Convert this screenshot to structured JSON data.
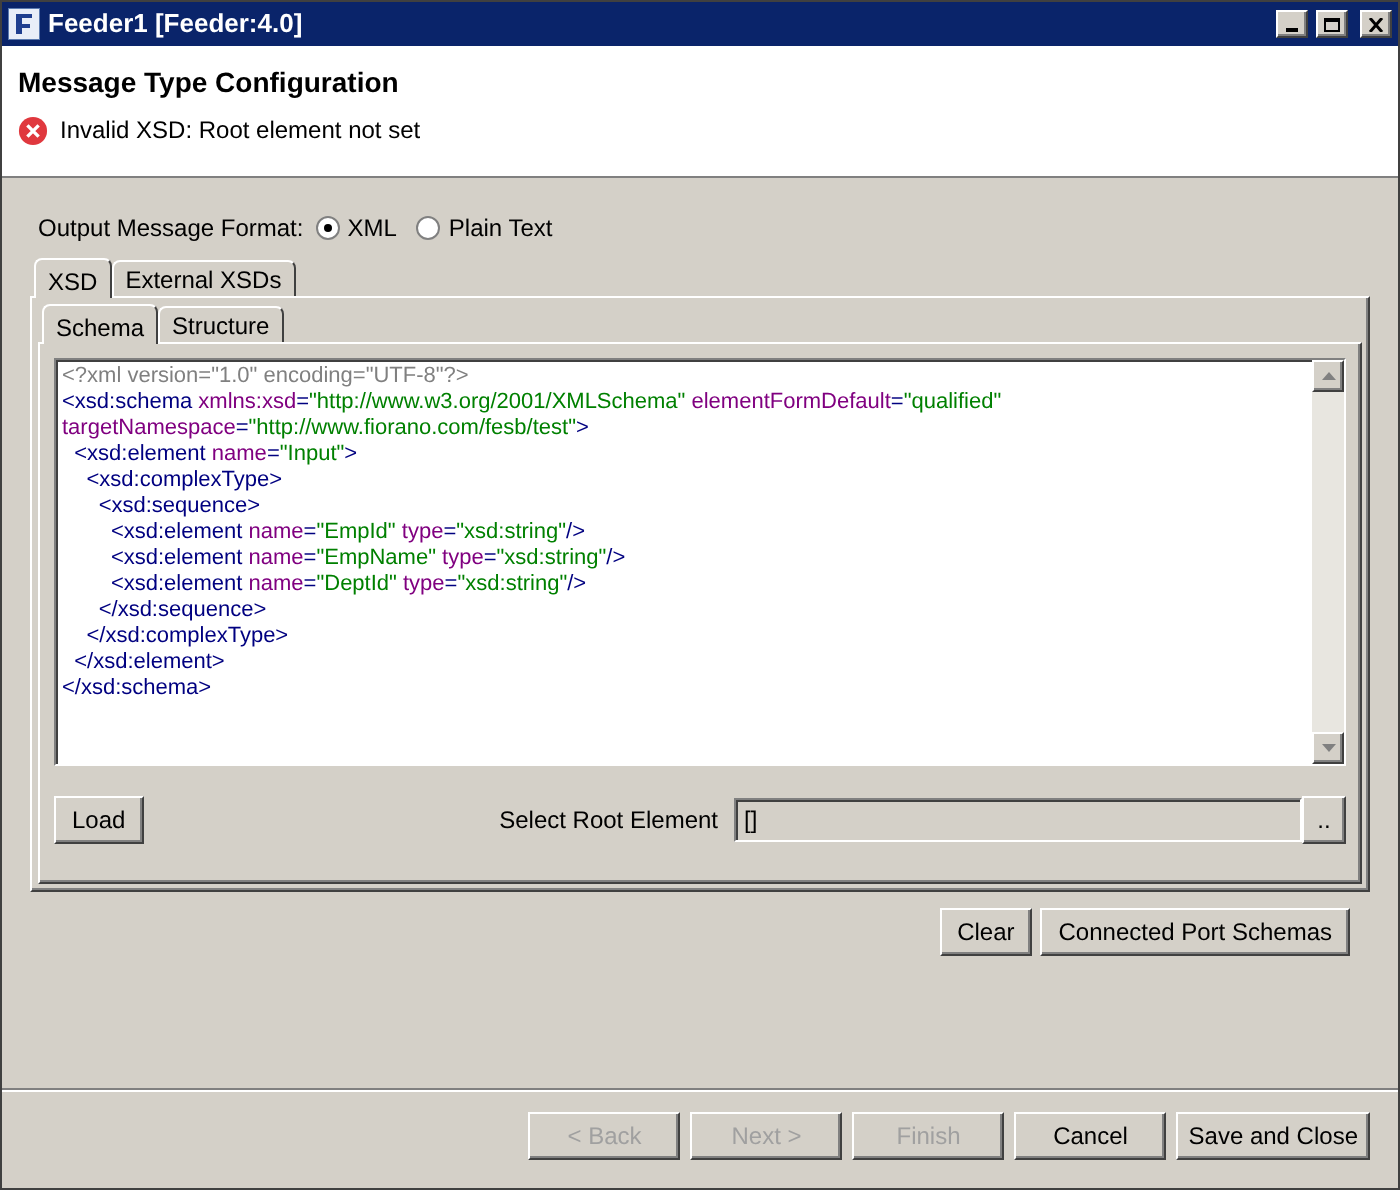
{
  "window": {
    "title": "Feeder1 [Feeder:4.0]"
  },
  "header": {
    "title": "Message Type Configuration",
    "error": "Invalid XSD: Root element not set"
  },
  "output_format": {
    "label": "Output Message Format:",
    "options": [
      {
        "label": "XML",
        "selected": true
      },
      {
        "label": "Plain Text",
        "selected": false
      }
    ]
  },
  "tabs": [
    {
      "label": "XSD",
      "selected": true
    },
    {
      "label": "External XSDs",
      "selected": false
    }
  ],
  "subtabs": [
    {
      "label": "Schema",
      "selected": true
    },
    {
      "label": "Structure",
      "selected": false
    }
  ],
  "editor": {
    "lines": [
      [
        {
          "kind": "decl",
          "text": "<?xml version=\"1.0\" encoding=\"UTF-8\"?>"
        }
      ],
      [
        {
          "kind": "tag",
          "text": "<xsd:schema "
        },
        {
          "kind": "attr",
          "text": "xmlns:xsd"
        },
        {
          "kind": "tag",
          "text": "="
        },
        {
          "kind": "value",
          "text": "\"http://www.w3.org/2001/XMLSchema\" "
        },
        {
          "kind": "attr",
          "text": "elementFormDefault"
        },
        {
          "kind": "tag",
          "text": "="
        },
        {
          "kind": "value",
          "text": "\"qualified\""
        }
      ],
      [
        {
          "kind": "attr",
          "text": "targetNamespace"
        },
        {
          "kind": "tag",
          "text": "="
        },
        {
          "kind": "value",
          "text": "\"http://www.fiorano.com/fesb/test\""
        },
        {
          "kind": "tag",
          "text": ">"
        }
      ],
      [
        {
          "kind": "tag",
          "text": "  <xsd:element "
        },
        {
          "kind": "attr",
          "text": "name"
        },
        {
          "kind": "tag",
          "text": "="
        },
        {
          "kind": "value",
          "text": "\"Input\""
        },
        {
          "kind": "tag",
          "text": ">"
        }
      ],
      [
        {
          "kind": "tag",
          "text": "    <xsd:complexType>"
        }
      ],
      [
        {
          "kind": "tag",
          "text": "      <xsd:sequence>"
        }
      ],
      [
        {
          "kind": "tag",
          "text": "        <xsd:element "
        },
        {
          "kind": "attr",
          "text": "name"
        },
        {
          "kind": "tag",
          "text": "="
        },
        {
          "kind": "value",
          "text": "\"EmpId\" "
        },
        {
          "kind": "attr",
          "text": "type"
        },
        {
          "kind": "tag",
          "text": "="
        },
        {
          "kind": "value",
          "text": "\"xsd:string\""
        },
        {
          "kind": "tag",
          "text": "/>"
        }
      ],
      [
        {
          "kind": "tag",
          "text": "        <xsd:element "
        },
        {
          "kind": "attr",
          "text": "name"
        },
        {
          "kind": "tag",
          "text": "="
        },
        {
          "kind": "value",
          "text": "\"EmpName\" "
        },
        {
          "kind": "attr",
          "text": "type"
        },
        {
          "kind": "tag",
          "text": "="
        },
        {
          "kind": "value",
          "text": "\"xsd:string\""
        },
        {
          "kind": "tag",
          "text": "/>"
        }
      ],
      [
        {
          "kind": "tag",
          "text": "        <xsd:element "
        },
        {
          "kind": "attr",
          "text": "name"
        },
        {
          "kind": "tag",
          "text": "="
        },
        {
          "kind": "value",
          "text": "\"DeptId\" "
        },
        {
          "kind": "attr",
          "text": "type"
        },
        {
          "kind": "tag",
          "text": "="
        },
        {
          "kind": "value",
          "text": "\"xsd:string\""
        },
        {
          "kind": "tag",
          "text": "/>"
        }
      ],
      [
        {
          "kind": "tag",
          "text": "      </xsd:sequence>"
        }
      ],
      [
        {
          "kind": "tag",
          "text": "    </xsd:complexType>"
        }
      ],
      [
        {
          "kind": "tag",
          "text": "  </xsd:element>"
        }
      ],
      [
        {
          "kind": "tag",
          "text": "</xsd:schema>"
        }
      ]
    ]
  },
  "load_button": "Load",
  "root_element": {
    "label": "Select Root Element",
    "value": "[]",
    "browse": ".."
  },
  "schema_buttons": [
    "Clear",
    "Connected Port Schemas"
  ],
  "footer_buttons": [
    {
      "label": "< Back",
      "disabled": true
    },
    {
      "label": "Next >",
      "disabled": true
    },
    {
      "label": "Finish",
      "disabled": true
    },
    {
      "label": "Cancel",
      "disabled": false
    },
    {
      "label": "Save and Close",
      "disabled": false
    }
  ]
}
